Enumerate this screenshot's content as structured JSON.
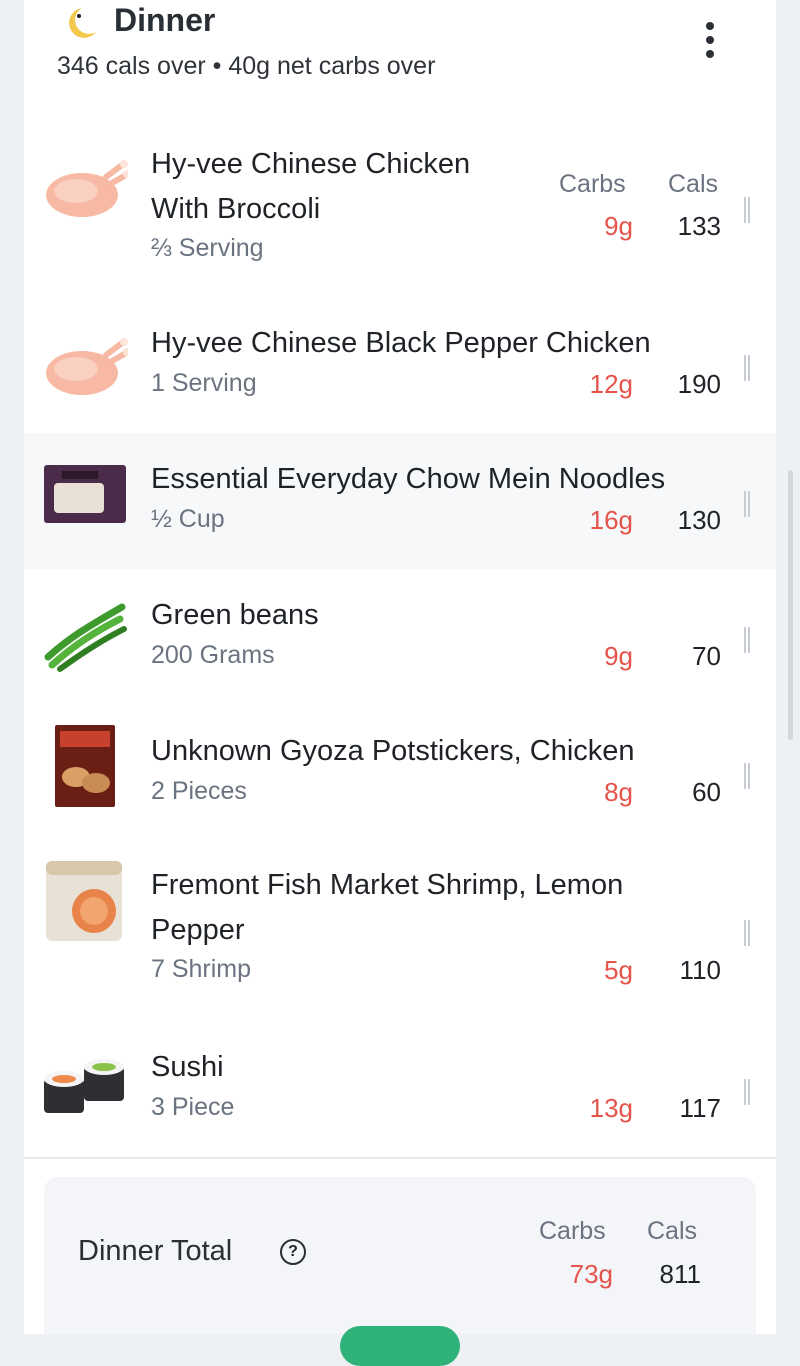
{
  "meal": {
    "title": "Dinner",
    "summary": "346 cals over • 40g net carbs over",
    "icon": "moon-icon"
  },
  "columns": {
    "carbs": "Carbs",
    "cals": "Cals"
  },
  "items": [
    {
      "name_line1": "Hy-vee Chinese Chicken",
      "name_line2": "With Broccoli",
      "serving": "⅔ Serving",
      "carbs": "9g",
      "cals": "133",
      "icon": "chicken-icon"
    },
    {
      "name_line1": "Hy-vee Chinese Black Pepper Chicken",
      "serving": "1 Serving",
      "carbs": "12g",
      "cals": "190",
      "icon": "chicken-icon"
    },
    {
      "name_line1": "Essential Everyday Chow Mein Noodles",
      "serving": "½ Cup",
      "carbs": "16g",
      "cals": "130",
      "icon": "noodle-package-image"
    },
    {
      "name_line1": "Green beans",
      "serving": "200 Grams",
      "carbs": "9g",
      "cals": "70",
      "icon": "green-beans-icon"
    },
    {
      "name_line1": "Unknown Gyoza Potstickers, Chicken",
      "serving": "2 Pieces",
      "carbs": "8g",
      "cals": "60",
      "icon": "gyoza-package-image"
    },
    {
      "name_line1": "Fremont Fish Market Shrimp, Lemon",
      "name_line2": "Pepper",
      "serving": "7 Shrimp",
      "carbs": "5g",
      "cals": "110",
      "icon": "shrimp-package-image"
    },
    {
      "name_line1": "Sushi",
      "serving": "3 Piece",
      "carbs": "13g",
      "cals": "117",
      "icon": "sushi-icon"
    }
  ],
  "total": {
    "title": "Dinner Total",
    "carbs_label": "Carbs",
    "cals_label": "Cals",
    "carbs": "73g",
    "cals": "811"
  },
  "colors": {
    "carbs": "#e5534b",
    "text": "#1f2328",
    "muted": "#6b7280",
    "accent": "#2fb27a"
  }
}
